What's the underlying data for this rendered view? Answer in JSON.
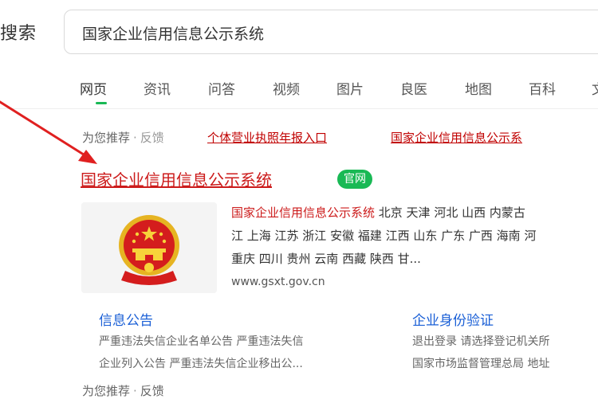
{
  "header": {
    "brand": "搜索",
    "search_value": "国家企业信用信息公示系统"
  },
  "tabs": [
    "网页",
    "资讯",
    "问答",
    "视频",
    "图片",
    "良医",
    "地图",
    "百科",
    "文"
  ],
  "recommend": {
    "label": "为您推荐",
    "feedback": "反馈",
    "links": [
      "个体营业执照年报入口",
      "国家企业信用信息公示系"
    ]
  },
  "result": {
    "title": "国家企业信用信息公示系统",
    "badge": "官网",
    "desc_highlight": "国家企业信用信息公示系统",
    "desc_line1_rest": " 北京 天津 河北 山西 内蒙古",
    "desc_line2": "江 上海 江苏 浙江 安徽 福建 江西 山东 广东 广西 海南 河",
    "desc_line3": "重庆 四川 贵州 云南 西藏 陕西 甘...",
    "url": "www.gsxt.gov.cn"
  },
  "sublinks": [
    {
      "title": "信息公告",
      "line1": "严重违法失信企业名单公告 严重违法失信",
      "line2": "企业列入公告 严重违法失信企业移出公..."
    },
    {
      "title": "企业身份验证",
      "line1": "退出登录 请选择登记机关所",
      "line2": "国家市场监督管理总局 地址"
    }
  ],
  "bottom": {
    "label": "为您推荐",
    "feedback": "反馈"
  },
  "colors": {
    "accent_green": "#19b955",
    "title_red": "#cc1b1b",
    "link_blue": "#1a5fd6",
    "arrow_red": "#e02020"
  },
  "icons": {
    "emblem": "national-emblem-icon",
    "arrow": "red-annotation-arrow"
  }
}
